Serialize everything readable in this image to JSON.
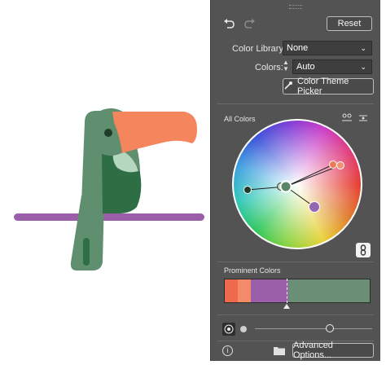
{
  "panel": {
    "reset_label": "Reset",
    "color_library_label": "Color Library:",
    "color_library_value": "None",
    "colors_label": "Colors:",
    "colors_value": "Auto",
    "theme_picker_label": "Color Theme Picker",
    "all_colors_label": "All Colors",
    "prominent_colors_label": "Prominent Colors",
    "advanced_label": "Advanced Options...",
    "prominent_segments": [
      {
        "color": "#ef6a4d",
        "fraction": 0.09
      },
      {
        "color": "#f38b6a",
        "fraction": 0.09
      },
      {
        "color": "#9b5ea8",
        "fraction": 0.26
      },
      {
        "color": "#6a8e76",
        "fraction": 0.56
      }
    ],
    "prominent_marker_fraction": 0.43,
    "saturation_slider_fraction": 0.64
  },
  "wheel_markers": [
    {
      "name": "dark-green",
      "color": "#1f3d2a",
      "size": "small"
    },
    {
      "name": "green-base",
      "color": "#5a8566",
      "size": "large"
    },
    {
      "name": "mint",
      "color": "#b8d6c0",
      "size": "small"
    },
    {
      "name": "orange-1",
      "color": "#f07a55",
      "size": "small"
    },
    {
      "name": "orange-2",
      "color": "#f29175",
      "size": "small"
    },
    {
      "name": "purple",
      "color": "#9468b0",
      "size": "medium"
    }
  ],
  "artwork": {
    "perch_color": "#9b5ea8",
    "body_color": "#5f8f6e",
    "wing_color": "#2e6e44",
    "throat_color": "#b6d7bf",
    "beak_color": "#f4855c",
    "eye_color": "#1f3d2a"
  }
}
